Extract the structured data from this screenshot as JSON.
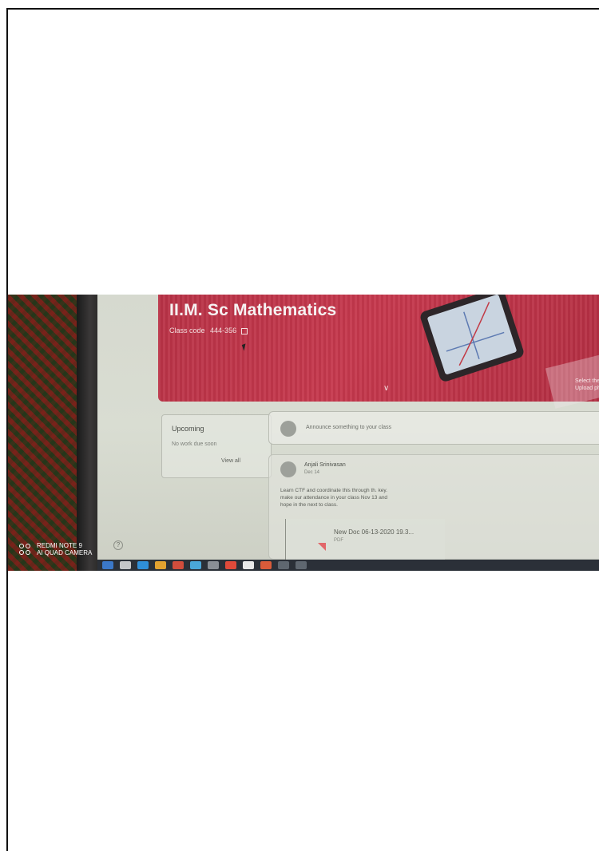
{
  "classroom": {
    "class_title": "II.M. Sc Mathematics",
    "class_code_label": "Class code",
    "class_code_value": "444-356",
    "select_theme_line1": "Select then",
    "select_theme_line2": "Upload pho"
  },
  "upcoming": {
    "title": "Upcoming",
    "empty_text": "No work due soon",
    "view_all_label": "View all"
  },
  "announce": {
    "placeholder": "Announce something to your class"
  },
  "post": {
    "author": "Anjali Srinivasan",
    "date": "Dec 14",
    "body": "Learn CTF and coordinate this through th. key. make our attendance in your class Nov 13 and hope in the next to class.",
    "attachment_title": "New Doc 06-13-2020 19.3...",
    "attachment_type": "PDF"
  },
  "watermark": {
    "line1": "REDMI NOTE 9",
    "line2": "AI QUAD CAMERA"
  },
  "colors": {
    "banner": "#c6384d",
    "taskbar": "#2b3038"
  }
}
